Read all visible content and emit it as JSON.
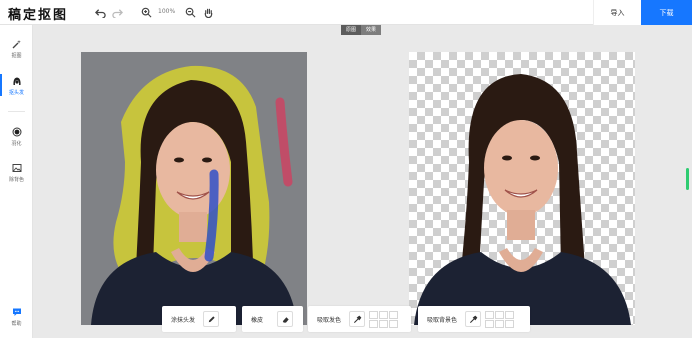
{
  "app": {
    "logo": "稿定抠图"
  },
  "toolbar": {
    "undo_icon": "undo-icon",
    "redo_icon": "redo-icon",
    "zoom_in_icon": "zoom-in-icon",
    "zoom_level": "100%",
    "zoom_out_icon": "zoom-out-icon",
    "hand_icon": "hand-icon",
    "import_label": "导入",
    "download_label": "下载"
  },
  "sidebar": {
    "items": [
      {
        "label": "抠图",
        "icon": "magic-wand-icon",
        "active": false
      },
      {
        "label": "抠头发",
        "icon": "hair-icon",
        "active": true
      },
      {
        "label": "羽化",
        "icon": "feather-icon",
        "active": false
      },
      {
        "label": "除背色",
        "icon": "image-icon",
        "active": false
      },
      {
        "label": "帮助",
        "icon": "help-chat-icon",
        "active": false
      }
    ]
  },
  "view_toggle": {
    "original": "原图",
    "result": "效果"
  },
  "tools": {
    "paint_hair": "涂抹头发",
    "eraser": "橡皮",
    "pick_hair_color": "吸取发色",
    "pick_bg_color": "吸取背景色"
  },
  "colors": {
    "accent": "#1677ff",
    "hair_brush": "#e5e01e",
    "keep_brush": "#3050c8",
    "remove_brush": "#d04060"
  }
}
